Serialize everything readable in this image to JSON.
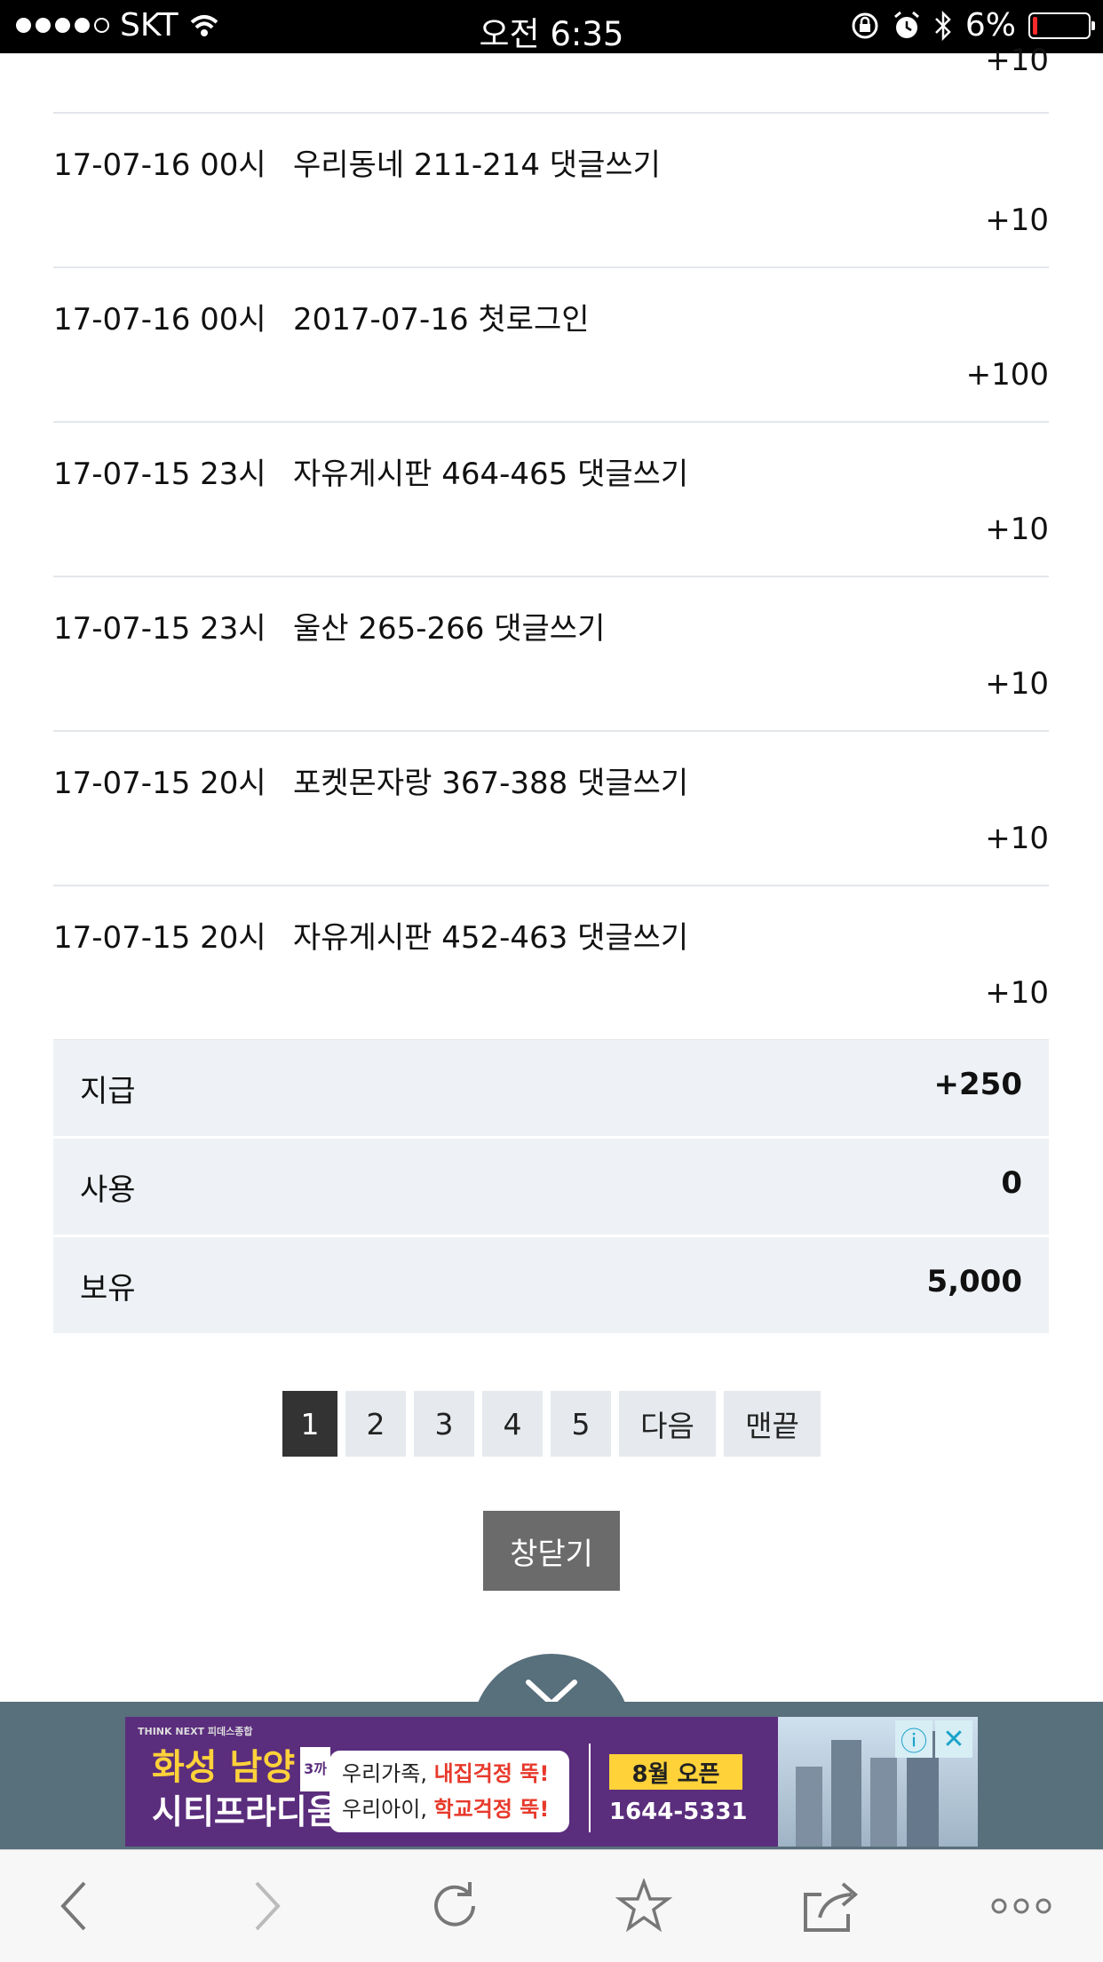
{
  "status_bar": {
    "carrier": "SKT",
    "time": "오전 6:35",
    "battery": "6%",
    "battery_color": "#ff2a2a"
  },
  "points_list": {
    "partial_row_amount": "+10",
    "rows": [
      {
        "date": "17-07-16 00시",
        "desc": "우리동네 211-214 댓글쓰기",
        "amount": "+10"
      },
      {
        "date": "17-07-16 00시",
        "desc": "2017-07-16 첫로그인",
        "amount": "+100"
      },
      {
        "date": "17-07-15 23시",
        "desc": "자유게시판 464-465 댓글쓰기",
        "amount": "+10"
      },
      {
        "date": "17-07-15 23시",
        "desc": "울산 265-266 댓글쓰기",
        "amount": "+10"
      },
      {
        "date": "17-07-15 20시",
        "desc": "포켓몬자랑 367-388 댓글쓰기",
        "amount": "+10"
      },
      {
        "date": "17-07-15 20시",
        "desc": "자유게시판 452-463 댓글쓰기",
        "amount": "+10"
      }
    ]
  },
  "summary": {
    "given_label": "지급",
    "given_value": "+250",
    "used_label": "사용",
    "used_value": "0",
    "held_label": "보유",
    "held_value": "5,000"
  },
  "pagination": {
    "pages": [
      "1",
      "2",
      "3",
      "4",
      "5"
    ],
    "active_page": "1",
    "next_label": "다음",
    "last_label": "맨끝"
  },
  "close_button": "창닫기",
  "ad": {
    "top_text": "THINK NEXT 피데스종합",
    "title_line1": "화성 남양",
    "badge": "3까",
    "title_line2": "시티프라디움",
    "bubble_line1_a": "우리가족, ",
    "bubble_line1_b": "내집걱정 뚝!",
    "bubble_line2_a": "우리아이, ",
    "bubble_line2_b": "학교걱정 뚝!",
    "open_text": "8월 오픈",
    "phone": "1644-5331",
    "info_icon": "info-icon",
    "close_icon": "close-icon"
  },
  "toolbar_icons": [
    "back-icon",
    "forward-icon",
    "reload-icon",
    "bookmark-icon",
    "share-icon",
    "more-icon"
  ],
  "colors": {
    "summary_bg": "#eef2f6",
    "divider": "#e3e6ea",
    "active_page_bg": "#333333",
    "page_bg": "#e6eaee",
    "close_button_bg": "#6b6b6b",
    "ad_bar_bg": "#586f7c"
  }
}
